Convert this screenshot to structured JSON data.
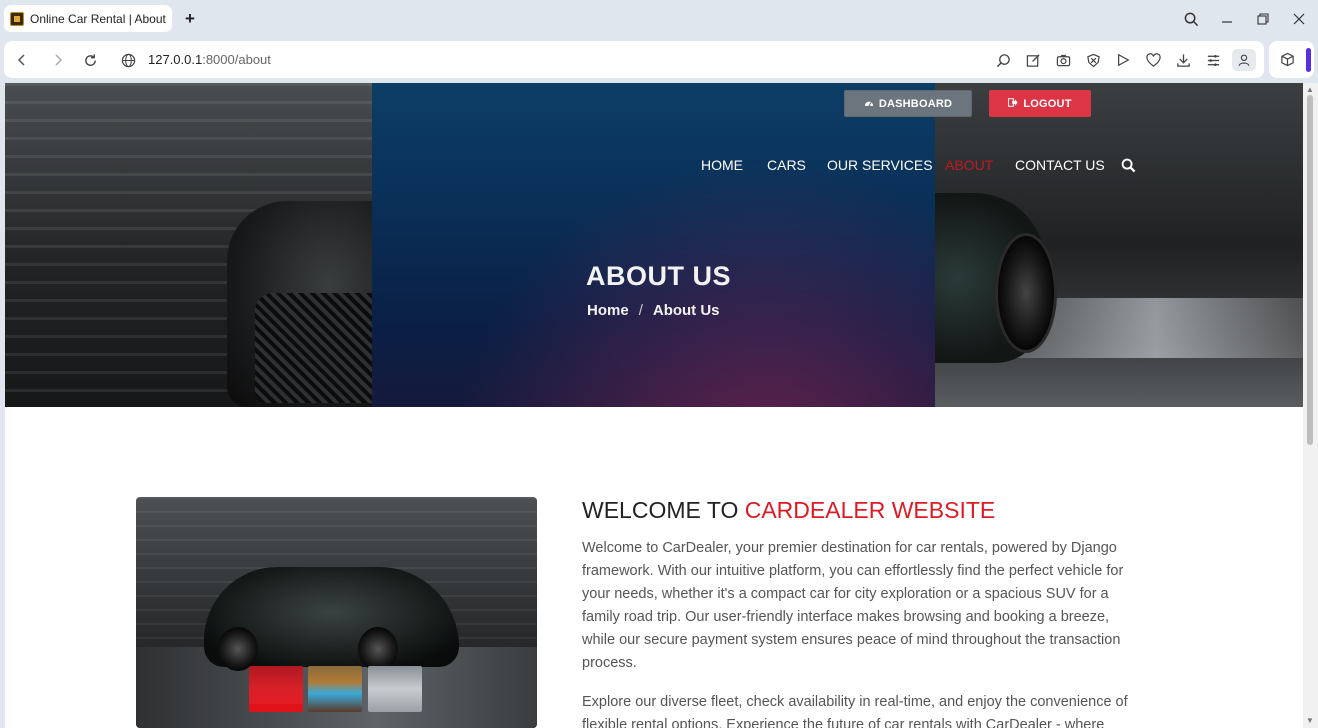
{
  "browser": {
    "tab_title": "Online Car Rental | About",
    "new_tab": "+",
    "url_host": "127.0.0.1",
    "url_path": ":8000/about"
  },
  "header": {
    "dashboard_label": "DASHBOARD",
    "logout_label": "LOGOUT",
    "nav": [
      {
        "label": "HOME",
        "active": false
      },
      {
        "label": "CARS",
        "active": false
      },
      {
        "label": "OUR SERVICES",
        "active": false
      },
      {
        "label": "ABOUT",
        "active": true
      },
      {
        "label": "CONTACT US",
        "active": false
      }
    ]
  },
  "hero": {
    "title": "ABOUT US",
    "breadcrumb_home": "Home",
    "breadcrumb_sep": "/",
    "breadcrumb_current": "About Us"
  },
  "about": {
    "heading_prefix": "WELCOME TO",
    "heading_accent": "CARDEALER WEBSITE",
    "paragraph_1": "Welcome to CarDealer, your premier destination for car rentals, powered by Django framework. With our intuitive platform, you can effortlessly find the perfect vehicle for your needs, whether it's a compact car for city exploration or a spacious SUV for a family road trip. Our user-friendly interface makes browsing and booking a breeze, while our secure payment system ensures peace of mind throughout the transaction process.",
    "paragraph_2": "Explore our diverse fleet, check availability in real-time, and enjoy the convenience of flexible rental options. Experience the future of car rentals with CarDealer - where"
  },
  "colors": {
    "accent_red": "#dc1b25",
    "nav_active": "#c01a24",
    "dashboard_btn": "#6c757d",
    "logout_btn": "#dc3545"
  },
  "icons": {
    "dashboard": "tachometer-icon",
    "logout": "sign-out-icon",
    "search": "search-icon"
  }
}
